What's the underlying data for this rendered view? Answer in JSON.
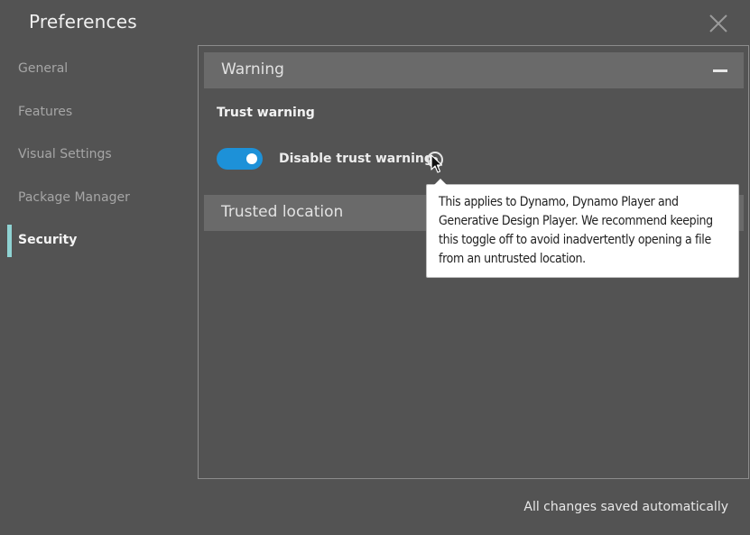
{
  "window": {
    "title": "Preferences",
    "footer_status": "All changes saved automatically"
  },
  "sidebar": {
    "items": [
      {
        "label": "General",
        "active": false
      },
      {
        "label": "Features",
        "active": false
      },
      {
        "label": "Visual Settings",
        "active": false
      },
      {
        "label": "Package Manager",
        "active": false
      },
      {
        "label": "Security",
        "active": true
      }
    ],
    "active_indicator_color": "#8fd3d3"
  },
  "content": {
    "sections": [
      {
        "label": "Warning",
        "expanded": true,
        "subheading": "Trust warning",
        "toggle": {
          "label": "Disable trust warning",
          "on": true,
          "color": "#1d91d8"
        },
        "info_icon": "help-circle-icon",
        "tooltip": {
          "text": "This applies to Dynamo, Dynamo Player and Generative Design Player. We recommend keeping this toggle off to avoid inadvertently opening a file from an untrusted location."
        }
      },
      {
        "label": "Trusted location",
        "expanded": false
      }
    ]
  }
}
